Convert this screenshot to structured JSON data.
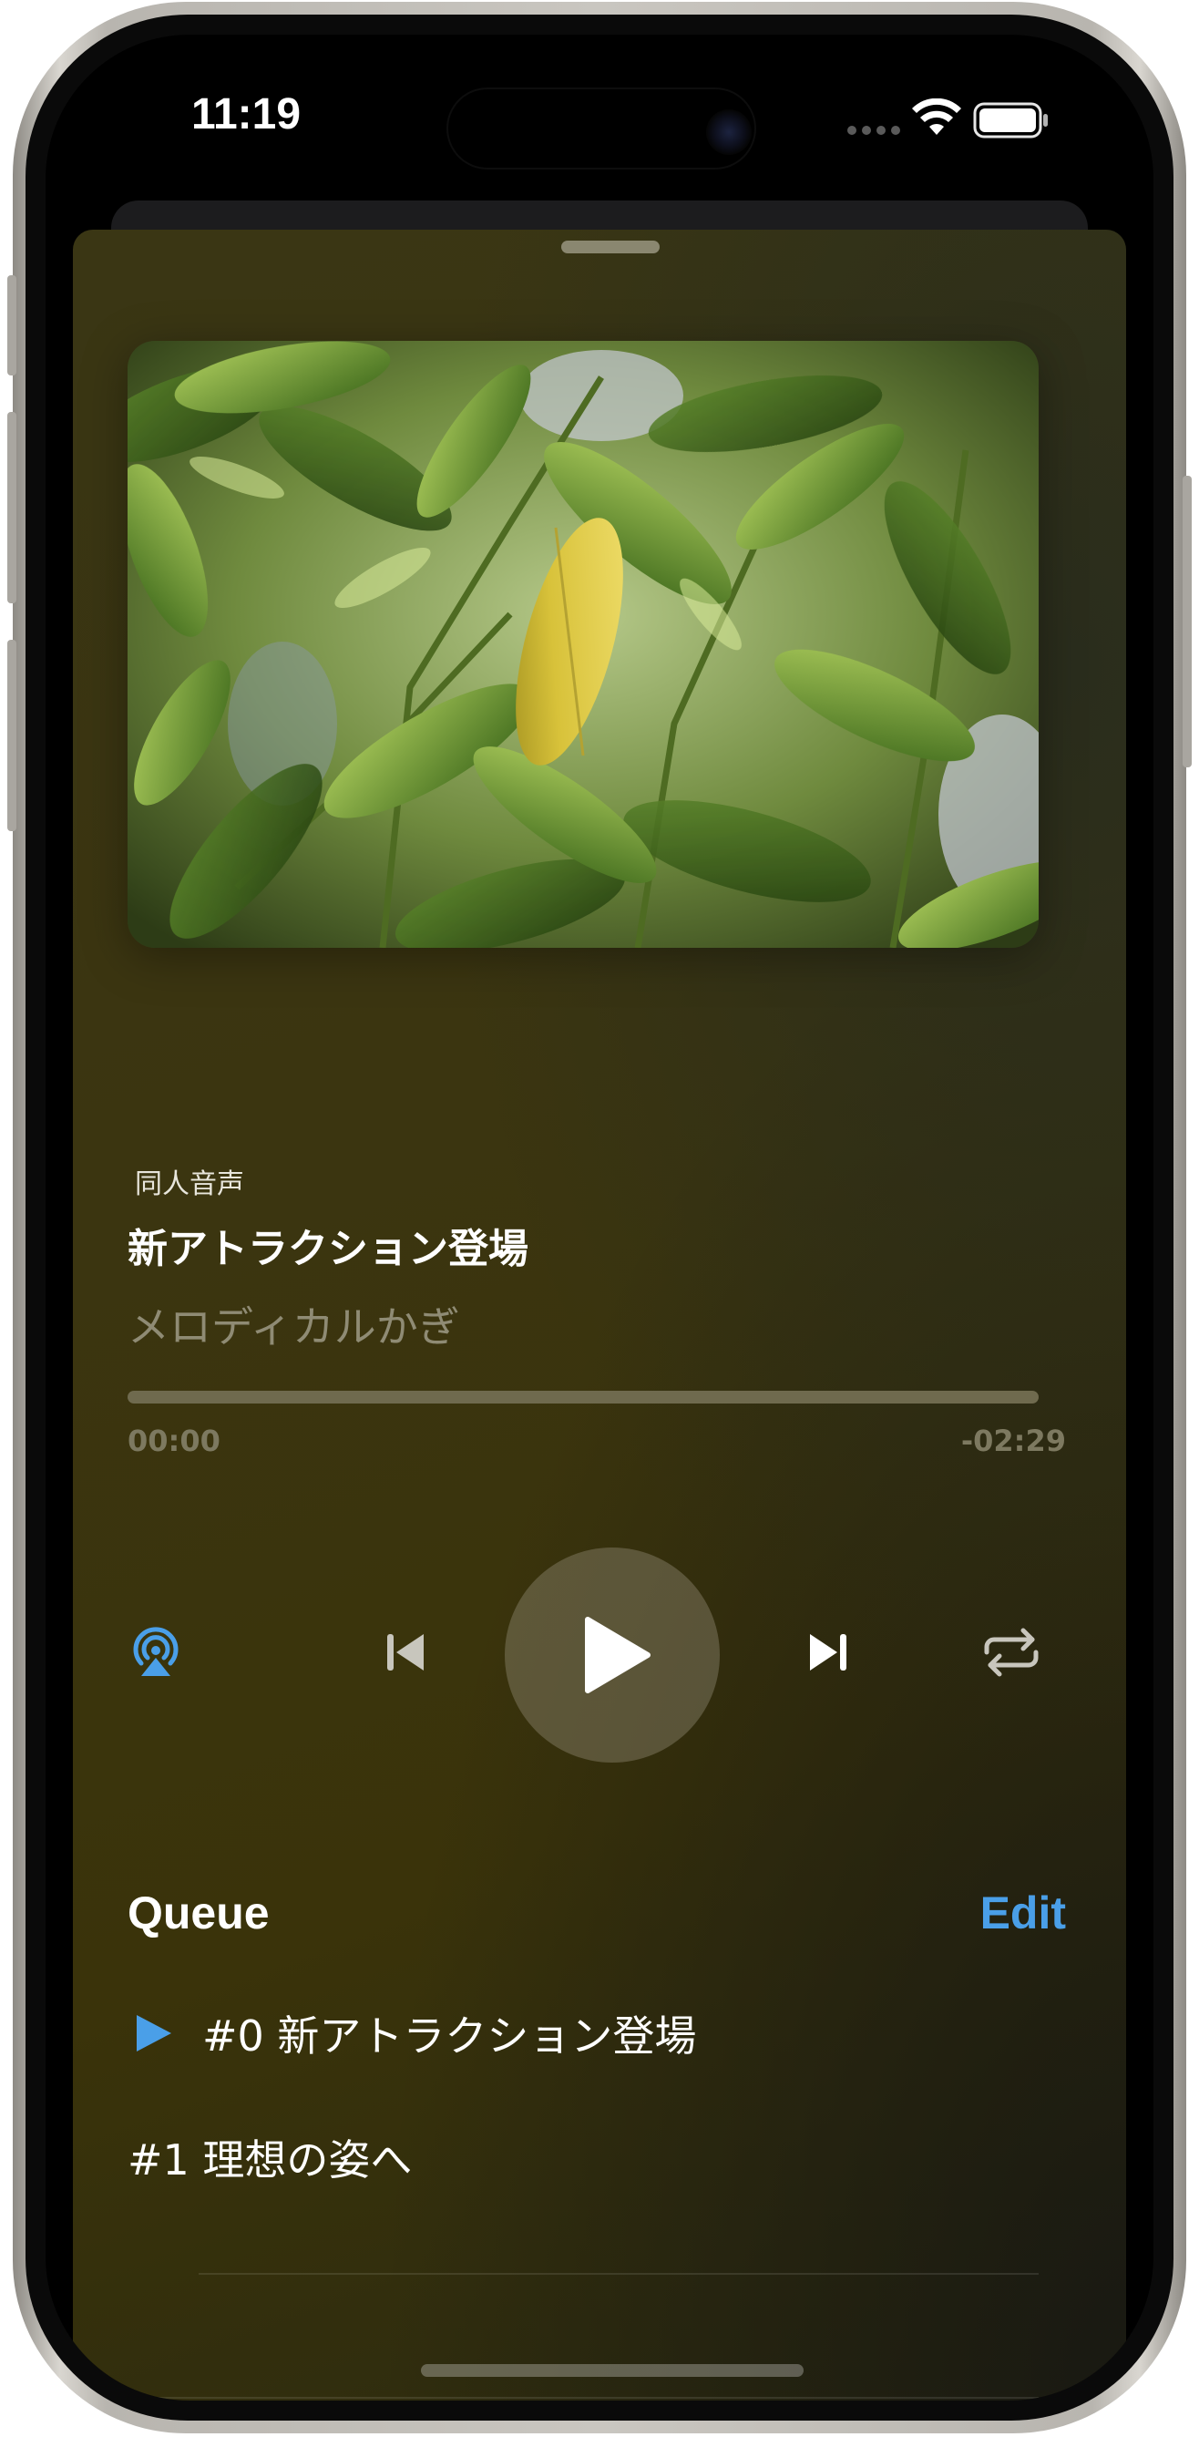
{
  "status_bar": {
    "time": "11:19"
  },
  "now_playing": {
    "album": "同人音声",
    "title": "新アトラクション登場",
    "artist": "メロディカルかぎ",
    "progress": 0.0,
    "elapsed": "00:00",
    "remaining": "-02:29"
  },
  "controls": {
    "airplay_icon": "airplay-icon",
    "previous_icon": "backward-end-icon",
    "play_icon": "play-icon",
    "next_icon": "forward-end-icon",
    "repeat_icon": "repeat-icon"
  },
  "queue": {
    "title": "Queue",
    "edit_label": "Edit",
    "items": [
      {
        "label": "#0 新アトラクション登場",
        "playing": true
      },
      {
        "label": "#1 理想の姿へ",
        "playing": false
      }
    ]
  },
  "colors": {
    "accent": "#4A9FE8",
    "background": "#3A3410"
  }
}
